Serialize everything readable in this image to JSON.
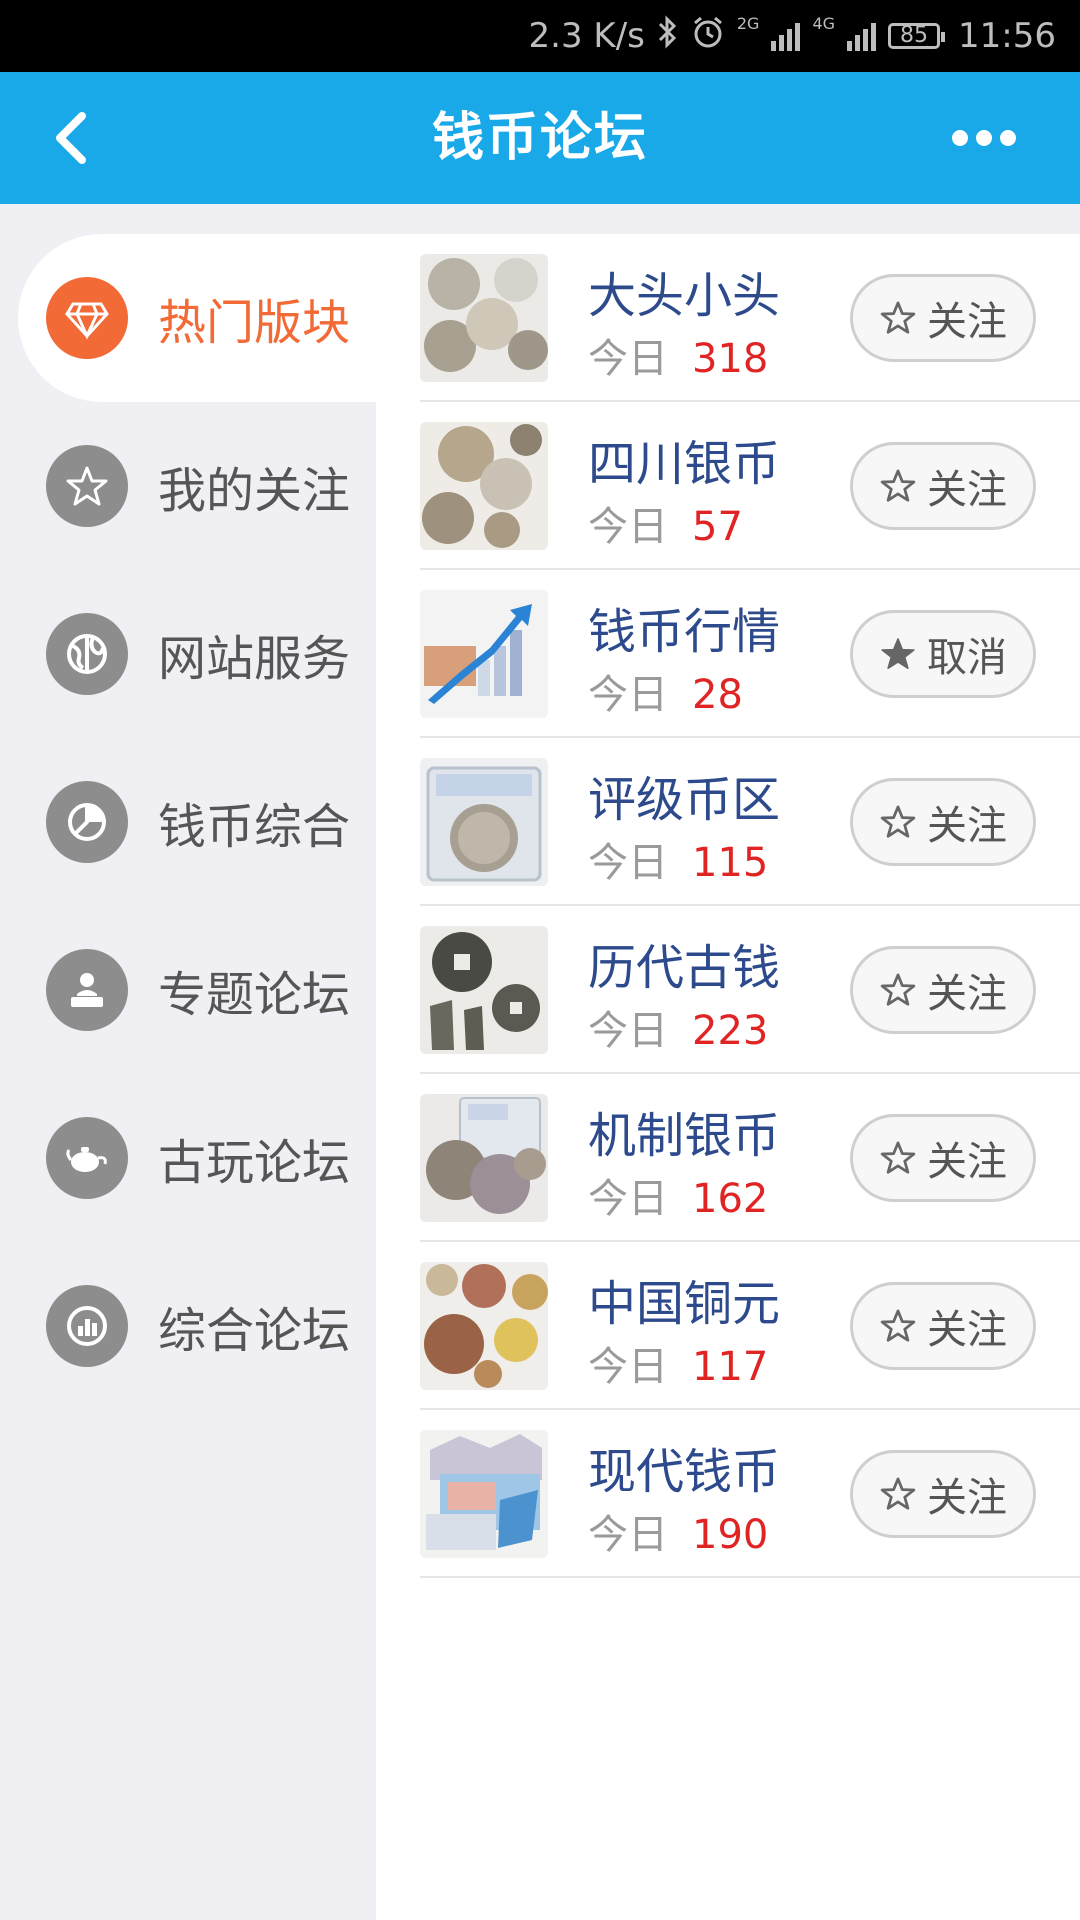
{
  "status_bar": {
    "speed": "2.3 K/s",
    "network1": "2G",
    "network2": "4G",
    "battery": "85",
    "time": "11:56"
  },
  "header": {
    "title": "钱币论坛",
    "back_icon": "chevron-left-icon",
    "more_icon": "more-dots-icon"
  },
  "sidebar": {
    "items": [
      {
        "label": "热门版块",
        "icon": "diamond-icon",
        "active": true
      },
      {
        "label": "我的关注",
        "icon": "star-icon",
        "active": false
      },
      {
        "label": "网站服务",
        "icon": "globe-icon",
        "active": false
      },
      {
        "label": "钱币综合",
        "icon": "pie-chart-icon",
        "active": false
      },
      {
        "label": "专题论坛",
        "icon": "speaker-icon",
        "active": false
      },
      {
        "label": "古玩论坛",
        "icon": "teapot-icon",
        "active": false
      },
      {
        "label": "综合论坛",
        "icon": "stats-icon",
        "active": false
      }
    ]
  },
  "forums": {
    "today_label": "今日",
    "items": [
      {
        "name": "大头小头",
        "today": "318",
        "button": "关注",
        "followed": false
      },
      {
        "name": "四川银币",
        "today": "57",
        "button": "关注",
        "followed": false
      },
      {
        "name": "钱币行情",
        "today": "28",
        "button": "取消",
        "followed": true
      },
      {
        "name": "评级币区",
        "today": "115",
        "button": "关注",
        "followed": false
      },
      {
        "name": "历代古钱",
        "today": "223",
        "button": "关注",
        "followed": false
      },
      {
        "name": "机制银币",
        "today": "162",
        "button": "关注",
        "followed": false
      },
      {
        "name": "中国铜元",
        "today": "117",
        "button": "关注",
        "followed": false
      },
      {
        "name": "现代钱币",
        "today": "190",
        "button": "关注",
        "followed": false
      }
    ]
  },
  "colors": {
    "header": "#1aa9e8",
    "active": "#f26a35",
    "count": "#e02424",
    "title": "#2c4a8c"
  }
}
